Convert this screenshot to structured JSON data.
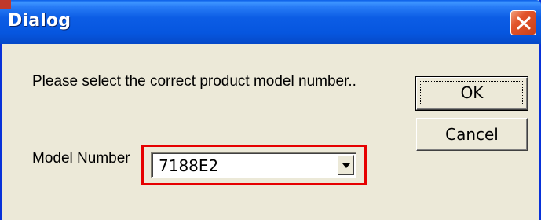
{
  "window": {
    "title": "Dialog"
  },
  "content": {
    "prompt": "Please  select  the correct product model number..",
    "model_label": "Model Number",
    "model_value": "7188E2"
  },
  "buttons": {
    "ok_label": "OK",
    "cancel_label": "Cancel"
  },
  "icons": {
    "close": "close-icon",
    "dropdown": "chevron-down-icon"
  },
  "colors": {
    "titlebar": "#0656df",
    "close_button": "#e2542b",
    "dialog_background": "#ece9d8",
    "highlight_box": "#e60000"
  }
}
